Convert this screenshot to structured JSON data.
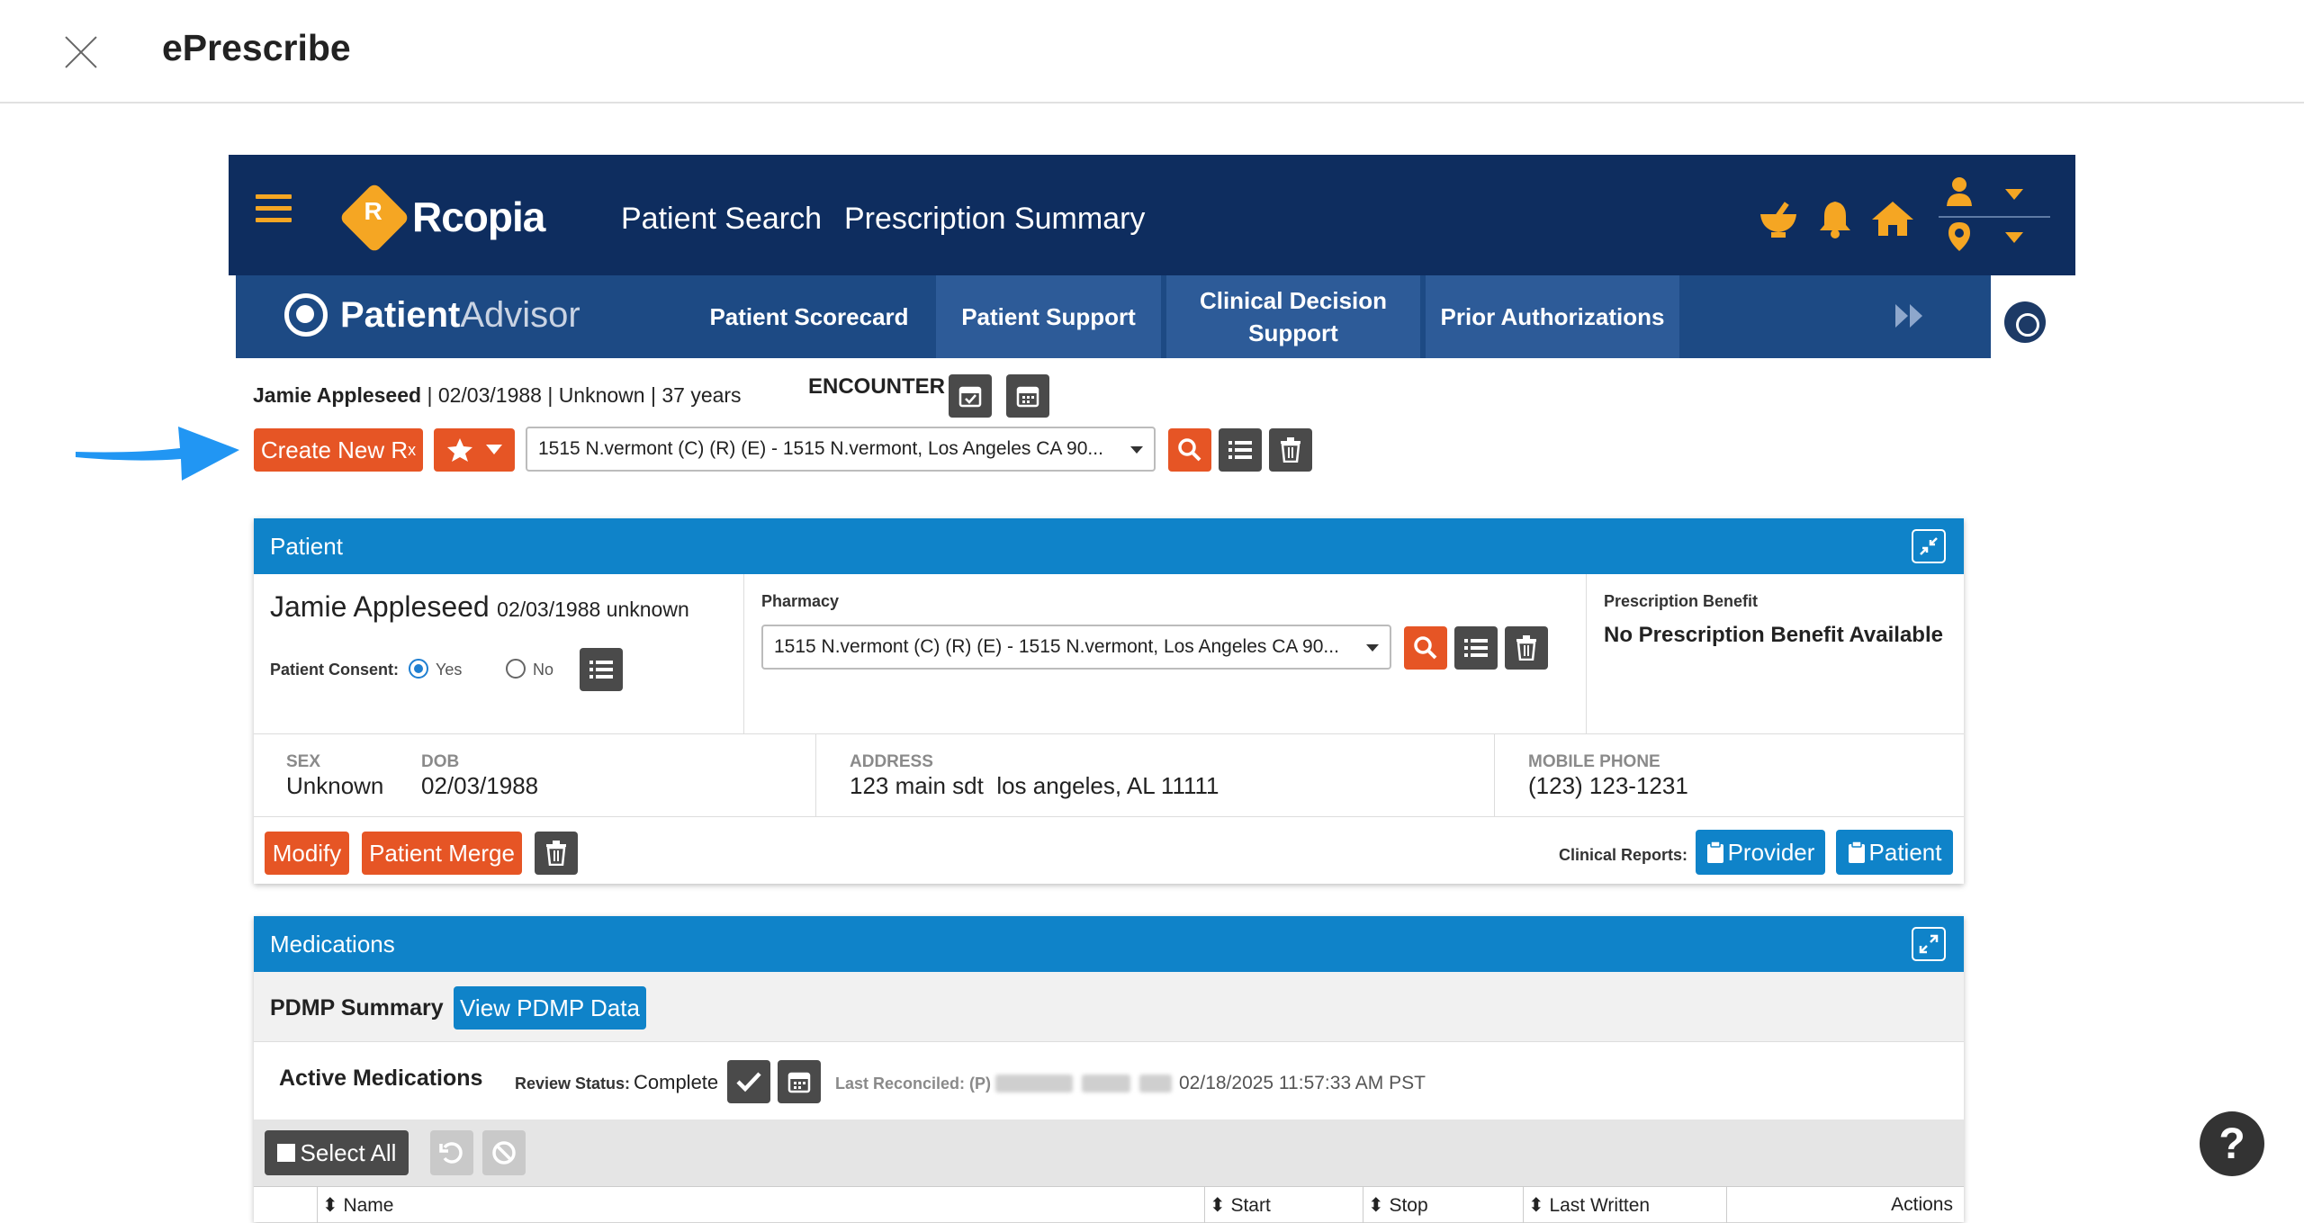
{
  "dialog": {
    "title": "ePrescribe"
  },
  "navbar": {
    "brand": "Rcopia",
    "brand_mark": "R",
    "links": [
      "Patient Search",
      "Prescription Summary"
    ],
    "accent_color": "#f5a623",
    "bg_color": "#0e2d5f"
  },
  "subnav": {
    "brand_bold": "Patient",
    "brand_light": "Advisor",
    "tabs": [
      "Patient Scorecard",
      "Patient Support",
      "Clinical Decision Support",
      "Prior Authorizations"
    ]
  },
  "patient_line": {
    "name": "Jamie Appleseed",
    "details": " | 02/03/1988 | Unknown | 37 years",
    "encounter_label": "ENCOUNTER"
  },
  "toolbar": {
    "create_rx": "Create New R",
    "create_rx_sub": "x",
    "pharmacy_value": "1515 N.vermont (C) (R) (E) - 1515 N.vermont, Los Angeles CA 90..."
  },
  "patient_panel": {
    "title": "Patient",
    "name": "Jamie Appleseed",
    "dob_sex": "02/03/1988 unknown",
    "consent_label": "Patient Consent:",
    "consent_yes": "Yes",
    "consent_no": "No",
    "pharmacy_label": "Pharmacy",
    "pharmacy_value": "1515 N.vermont (C) (R) (E) - 1515 N.vermont, Los Angeles CA 90...",
    "benefit_label": "Prescription Benefit",
    "benefit_value": "No Prescription Benefit Available",
    "sex_label": "SEX",
    "sex_value": "Unknown",
    "dob_label": "DOB",
    "dob_value": "02/03/1988",
    "address_label": "ADDRESS",
    "address_value": "123 main sdt  los angeles, AL 11111",
    "phone_label": "MOBILE PHONE",
    "phone_value": "(123) 123-1231",
    "modify": "Modify",
    "merge": "Patient Merge",
    "clinical_reports_label": "Clinical Reports:",
    "provider_btn": "Provider",
    "patient_btn": "Patient"
  },
  "medications_panel": {
    "title": "Medications",
    "pdmp_label": "PDMP Summary",
    "pdmp_btn": "View PDMP Data",
    "active_label": "Active Medications",
    "review_label": "Review Status:",
    "review_value": "Complete",
    "last_reconciled_label": "Last Reconciled: (P)",
    "last_reconciled_value": "02/18/2025 11:57:33 AM PST",
    "select_all": "Select All",
    "columns": [
      "Name",
      "Start",
      "Stop",
      "Last Written",
      "Actions"
    ]
  },
  "help": {
    "label": "?"
  }
}
